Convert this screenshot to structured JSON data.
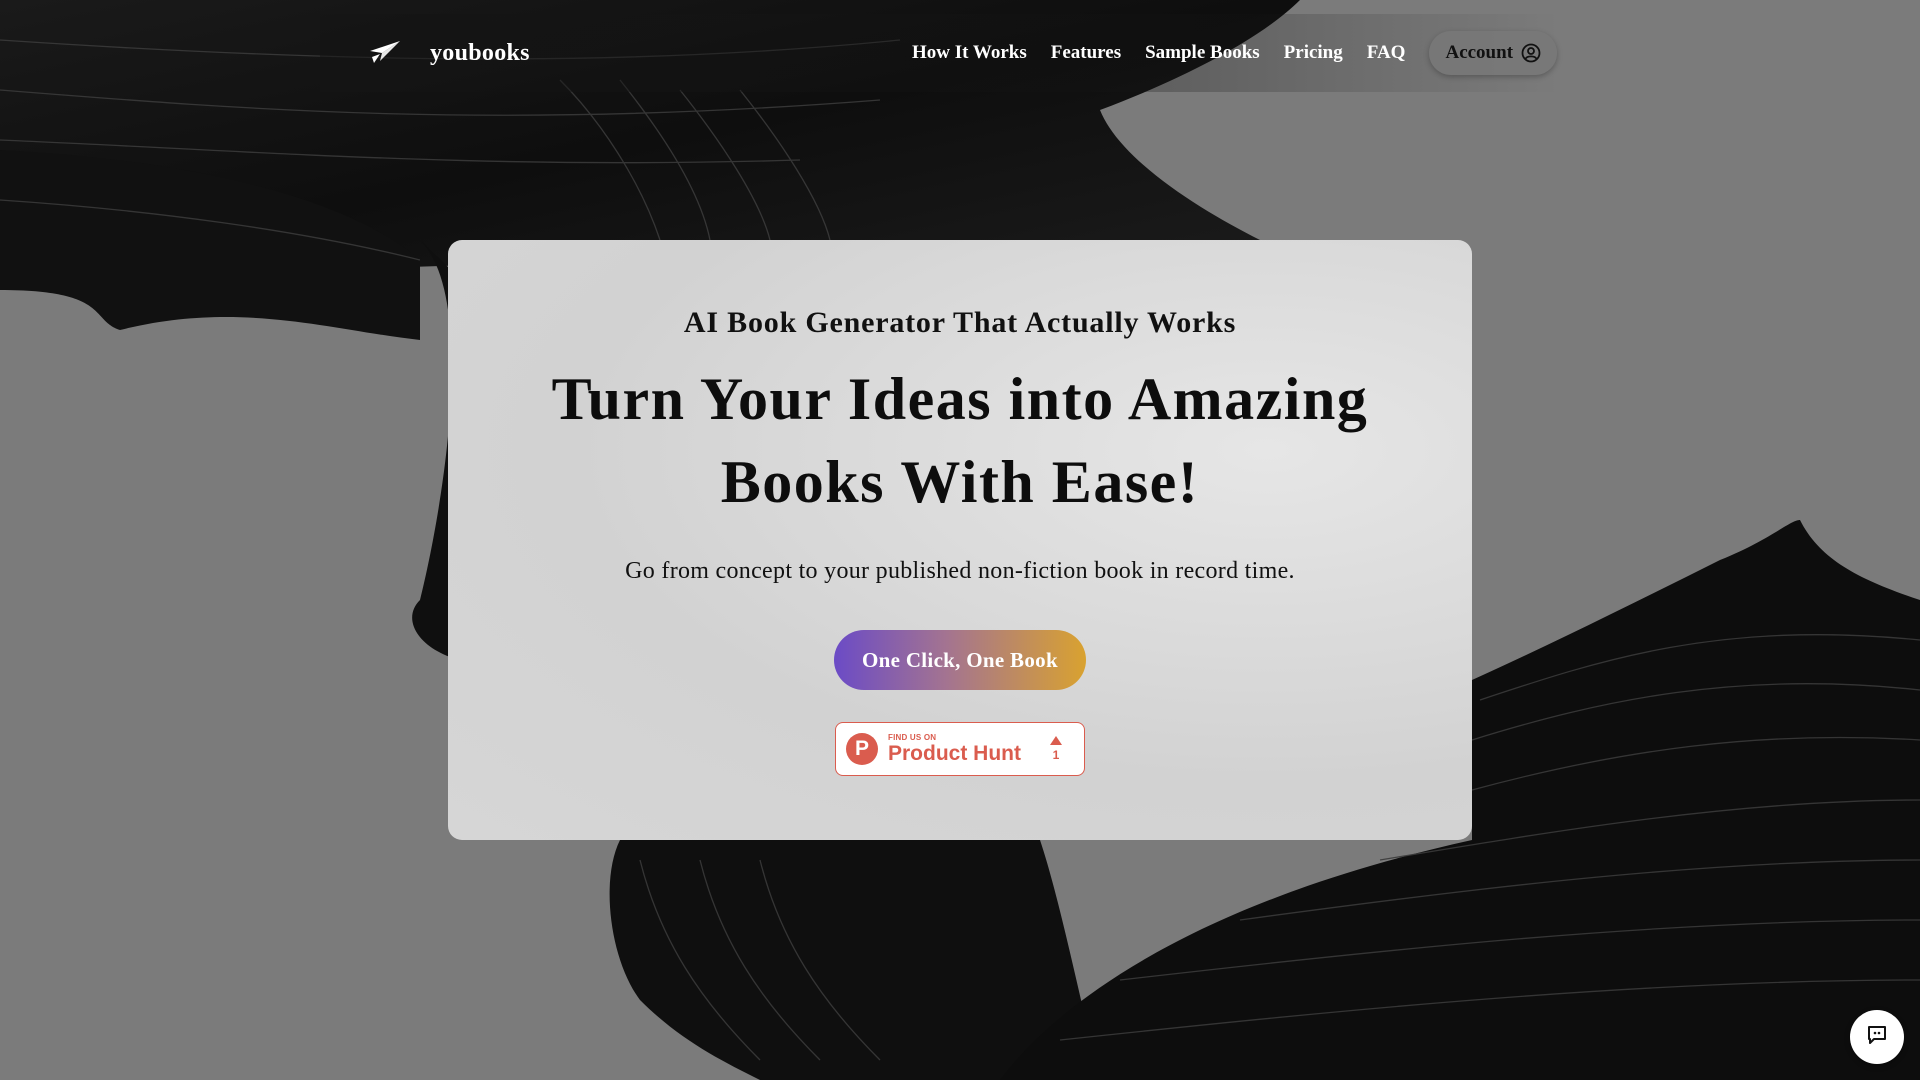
{
  "header": {
    "brand": "youbooks",
    "logo_icon": "paper-plane-icon",
    "nav": [
      {
        "label": "How It Works"
      },
      {
        "label": "Features"
      },
      {
        "label": "Sample Books"
      },
      {
        "label": "Pricing"
      },
      {
        "label": "FAQ"
      }
    ],
    "account": {
      "label": "Account",
      "icon": "user-circle-icon"
    }
  },
  "hero": {
    "eyebrow": "AI Book Generator That Actually Works",
    "headline_line1": "Turn Your Ideas into Amazing",
    "headline_line2": "Books With Ease!",
    "subtext": "Go from concept to your published non-fiction book in record time.",
    "cta_label": "One Click, One Book",
    "cta_gradient": [
      "#6b4bc6",
      "#d9a230"
    ]
  },
  "product_hunt_badge": {
    "logo_letter": "P",
    "small_text": "FIND US ON",
    "big_text": "Product Hunt",
    "upvotes": "1",
    "color": "#da5c4e"
  },
  "chat_widget": {
    "icon": "chat-bubble-icon"
  }
}
